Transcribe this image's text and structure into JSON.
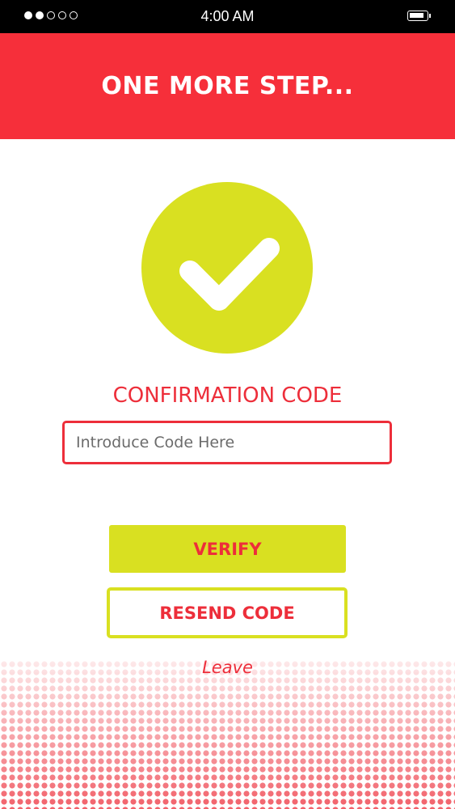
{
  "status_bar": {
    "time": "4:00 AM",
    "signal_dots_filled": 2,
    "signal_dots_total": 5,
    "battery_icon": "battery-icon"
  },
  "header": {
    "title": "ONE MORE STEP..."
  },
  "confirmation": {
    "icon": "checkmark-icon",
    "label": "CONFIRMATION CODE",
    "input_value": "",
    "input_placeholder": "Introduce Code Here"
  },
  "actions": {
    "verify_label": "VERIFY",
    "resend_label": "RESEND CODE",
    "leave_label": "Leave"
  },
  "colors": {
    "primary_red": "#f62f3a",
    "accent_lime": "#d9e021",
    "text_red": "#ed2e3a"
  }
}
